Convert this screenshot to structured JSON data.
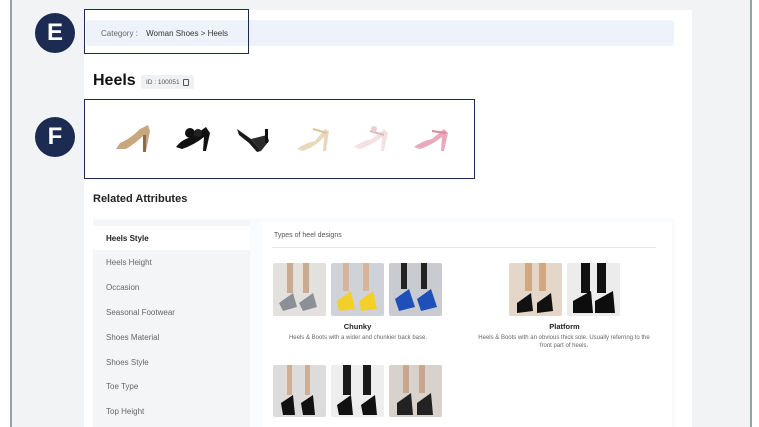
{
  "badges": {
    "e": "E",
    "f": "F"
  },
  "category": {
    "label": "Category :",
    "path": "Woman Shoes > Heels"
  },
  "product": {
    "title": "Heels",
    "id_text": "ID : 100051"
  },
  "thumbnails": [
    "heel-nude-pump-icon",
    "heel-black-bow-icon",
    "heel-black-pump-icon",
    "heel-cream-strap-icon",
    "heel-white-strap-icon",
    "heel-pink-strap-icon"
  ],
  "related": {
    "title": "Related Attributes",
    "sidebar": [
      "Heels Style",
      "Heels Height",
      "Occasion",
      "Seasonal Footwear",
      "Shoes Material",
      "Shoes Style",
      "Toe Type",
      "Top Height"
    ],
    "active_index": 0,
    "content_header": "Types of heel designs",
    "groups": [
      {
        "name": "Chunky",
        "description": "Heels & Boots with a wider and chunkier back base."
      },
      {
        "name": "Platform",
        "description": "Heels & Boots with an obvious thick sole. Usually referring to the front part of heels."
      }
    ]
  },
  "colors": {
    "badge": "#1b2b52",
    "highlight_border": "#1b2b52",
    "category_bg": "#eef3fb"
  }
}
